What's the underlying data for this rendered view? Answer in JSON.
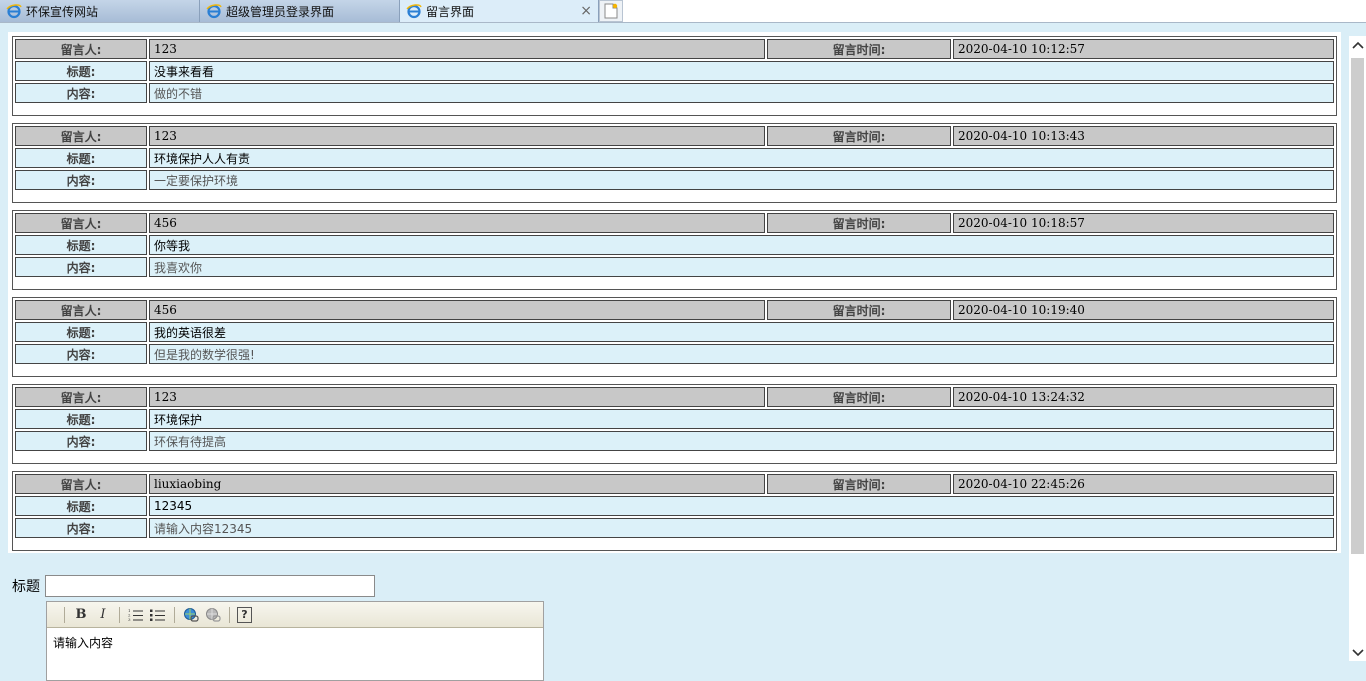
{
  "tabs": [
    {
      "label": "环保宣传网站",
      "active": false
    },
    {
      "label": "超级管理员登录界面",
      "active": false
    },
    {
      "label": "留言界面",
      "active": true
    }
  ],
  "tab_close": "×",
  "labels": {
    "author": "留言人:",
    "time": "留言时间:",
    "title": "标题:",
    "content": "内容:"
  },
  "messages": [
    {
      "author": "123",
      "time": "2020-04-10 10:12:57",
      "title": "没事来看看",
      "content": "做的不错"
    },
    {
      "author": "123",
      "time": "2020-04-10 10:13:43",
      "title": "环境保护人人有责",
      "content": "一定要保护环境"
    },
    {
      "author": "456",
      "time": "2020-04-10 10:18:57",
      "title": "你等我",
      "content": "我喜欢你"
    },
    {
      "author": "456",
      "time": "2020-04-10 10:19:40",
      "title": "我的英语很差",
      "content": "但是我的数学很强!"
    },
    {
      "author": "123",
      "time": "2020-04-10 13:24:32",
      "title": "环境保护",
      "content": "环保有待提高"
    },
    {
      "author": "liuxiaobing",
      "time": "2020-04-10 22:45:26",
      "title": "12345",
      "content": "请输入内容12345"
    }
  ],
  "form": {
    "title_label": "标题",
    "title_value": "",
    "editor_text": "请输入内容",
    "toolbar": {
      "bold": "B",
      "italic": "I",
      "help": "?"
    }
  },
  "colors": {
    "page_bg": "#daeef7",
    "header_row_bg": "#c8c8c8",
    "row_bg": "#dcf1f9"
  }
}
